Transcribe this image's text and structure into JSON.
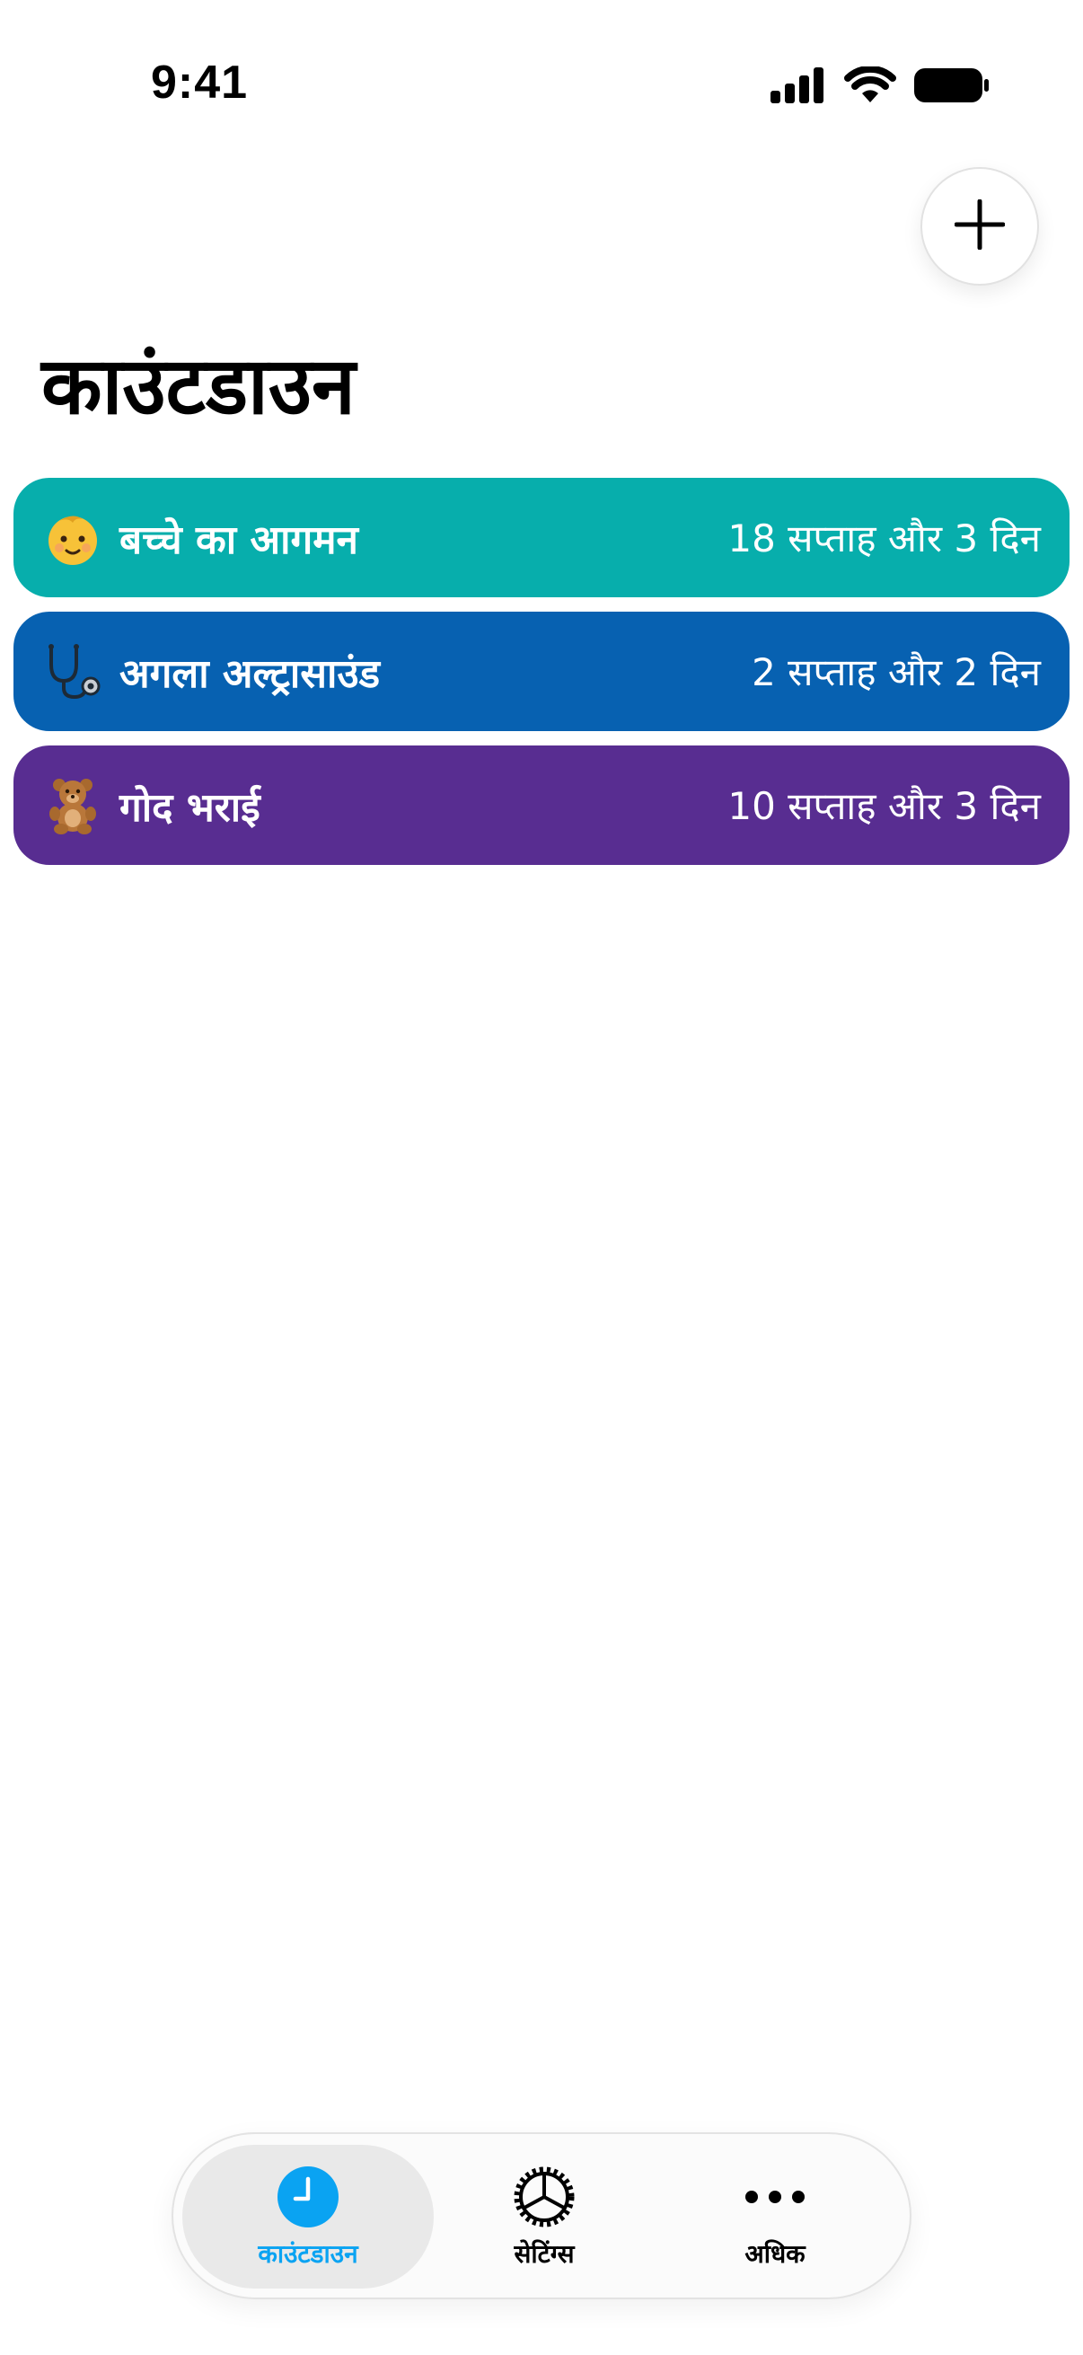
{
  "status_bar": {
    "time": "9:41"
  },
  "header": {
    "add_button_icon": "plus-icon",
    "title": "काउंटडाउन"
  },
  "countdowns": [
    {
      "emoji": "baby-emoji",
      "name": "बच्चे का आगमन",
      "remaining": "18 सप्ताह और 3 दिन",
      "color": "#07aeac"
    },
    {
      "emoji": "stethoscope-emoji",
      "name": "अगला अल्ट्रासाउंड",
      "remaining": "2 सप्ताह और 2 दिन",
      "color": "#0761b1"
    },
    {
      "emoji": "teddy-bear-emoji",
      "name": "गोद भराई",
      "remaining": "10 सप्ताह और 3 दिन",
      "color": "#582d91"
    }
  ],
  "tab_bar": {
    "tabs": [
      {
        "label": "काउंटडाउन",
        "icon": "clock-icon",
        "active": true
      },
      {
        "label": "सेटिंग्स",
        "icon": "gear-icon",
        "active": false
      },
      {
        "label": "अधिक",
        "icon": "more-icon",
        "active": false
      }
    ],
    "accent_color": "#0aa3f2"
  }
}
